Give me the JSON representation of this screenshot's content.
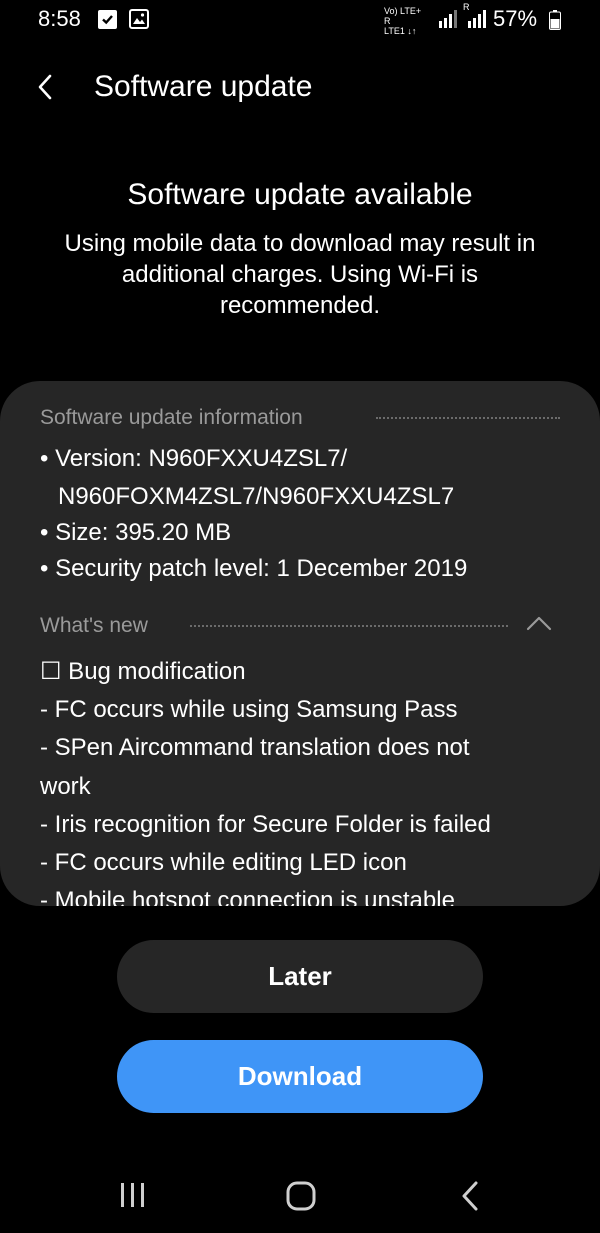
{
  "status_bar": {
    "time": "8:58",
    "network_label_top": "Vo) LTE+ R",
    "network_label_bottom": "LTE1 ↓↑",
    "roaming_label": "R",
    "battery_percent": "57%",
    "icons": [
      "checkbox-notification-icon",
      "image-notification-icon",
      "signal-icon",
      "battery-icon"
    ]
  },
  "header": {
    "back_icon": "chevron-left-icon",
    "title": "Software update"
  },
  "main": {
    "headline": "Software update available",
    "description": "Using mobile data to download may result in additional charges. Using Wi-Fi is recommended."
  },
  "info_card": {
    "info_heading": "Software update information",
    "version_line1": "• Version: N960FXXU4ZSL7/",
    "version_line2": "N960FOXM4ZSL7/N960FXXU4ZSL7",
    "size": "• Size: 395.20 MB",
    "security_patch": "• Security patch level: 1 December 2019",
    "whats_new_heading": "What's new",
    "whats_new_lines": [
      "☐ Bug modification",
      "- FC occurs while using Samsung Pass",
      "- SPen Aircommand translation does not",
      "work",
      "- Iris recognition for Secure Folder is failed",
      "- FC occurs while editing LED icon",
      "- Mobile hotspot connection is unstable"
    ]
  },
  "buttons": {
    "later": "Later",
    "download": "Download"
  },
  "colors": {
    "background": "#000000",
    "card": "#262626",
    "accent": "#3f95f7",
    "muted_text": "#9a9a9a"
  },
  "nav_bar": {
    "icons": [
      "recent-apps-icon",
      "home-icon",
      "back-nav-icon"
    ]
  }
}
